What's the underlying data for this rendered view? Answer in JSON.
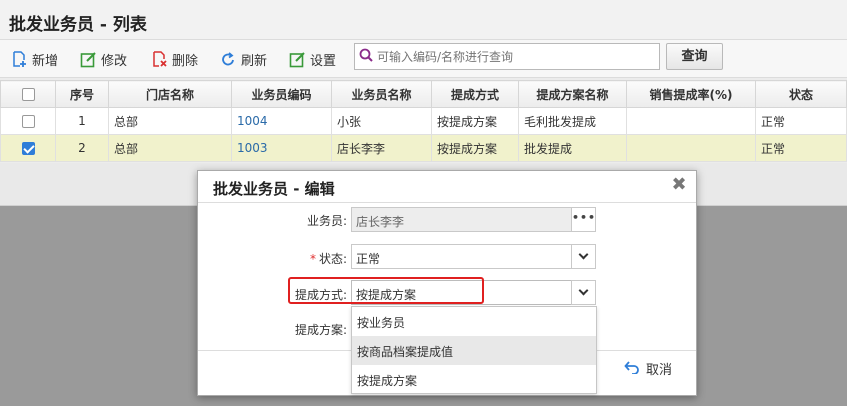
{
  "page": {
    "title": "批发业务员 - 列表"
  },
  "toolbar": {
    "add": "新增",
    "edit": "修改",
    "delete": "删除",
    "refresh": "刷新",
    "settings": "设置",
    "search_placeholder": "可输入编码/名称进行查询",
    "query": "查询"
  },
  "table": {
    "headers": [
      "序号",
      "门店名称",
      "业务员编码",
      "业务员名称",
      "提成方式",
      "提成方案名称",
      "销售提成率(%)",
      "状态"
    ],
    "rows": [
      {
        "checked": false,
        "no": "1",
        "store": "总部",
        "code": "1004",
        "name": "小张",
        "method": "按提成方案",
        "plan": "毛利批发提成",
        "rate": "",
        "status": "正常"
      },
      {
        "checked": true,
        "no": "2",
        "store": "总部",
        "code": "1003",
        "name": "店长李李",
        "method": "按提成方案",
        "plan": "批发提成",
        "rate": "",
        "status": "正常"
      }
    ]
  },
  "dialog": {
    "title": "批发业务员 - 编辑",
    "salesman_label": "业务员:",
    "salesman_value": "店长李李",
    "status_label": "状态:",
    "status_value": "正常",
    "method_label": "提成方式:",
    "method_value": "按提成方案",
    "plan_label": "提成方案:",
    "cancel": "取消",
    "dropdown_options": [
      "按业务员",
      "按商品档案提成值",
      "按提成方案"
    ]
  },
  "colors": {
    "selected_row": "#f1f2cc",
    "highlight": "#e02020",
    "link": "#2a6aa8"
  }
}
